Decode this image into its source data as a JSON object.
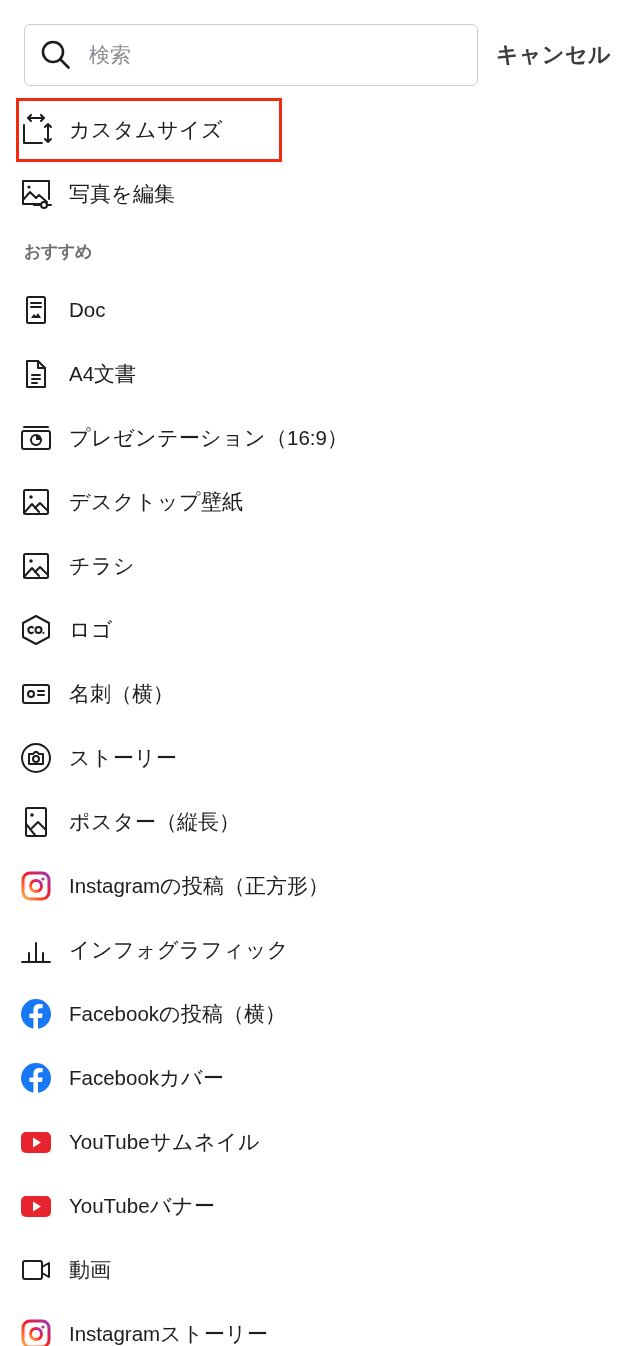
{
  "search": {
    "placeholder": "検索"
  },
  "cancel_button": "キャンセル",
  "items": [
    {
      "label": "カスタムサイズ",
      "kind": "resize",
      "highlighted": true
    },
    {
      "label": "写真を編集",
      "kind": "photo-edit",
      "highlighted": false
    }
  ],
  "recommended": {
    "heading": "おすすめ",
    "items": [
      {
        "label": "Doc",
        "kind": "doc"
      },
      {
        "label": "A4文書",
        "kind": "page"
      },
      {
        "label": "プレゼンテーション（16:9）",
        "kind": "presentation"
      },
      {
        "label": "デスクトップ壁紙",
        "kind": "image"
      },
      {
        "label": "チラシ",
        "kind": "image"
      },
      {
        "label": "ロゴ",
        "kind": "logo"
      },
      {
        "label": "名刺（横）",
        "kind": "card"
      },
      {
        "label": "ストーリー",
        "kind": "camera"
      },
      {
        "label": "ポスター（縦長）",
        "kind": "poster"
      },
      {
        "label": "Instagramの投稿（正方形）",
        "kind": "instagram"
      },
      {
        "label": "インフォグラフィック",
        "kind": "chart"
      },
      {
        "label": "Facebookの投稿（横）",
        "kind": "facebook"
      },
      {
        "label": "Facebookカバー",
        "kind": "facebook"
      },
      {
        "label": "YouTubeサムネイル",
        "kind": "youtube"
      },
      {
        "label": "YouTubeバナー",
        "kind": "youtube"
      },
      {
        "label": "動画",
        "kind": "video"
      },
      {
        "label": "Instagramストーリー",
        "kind": "instagram"
      }
    ]
  }
}
